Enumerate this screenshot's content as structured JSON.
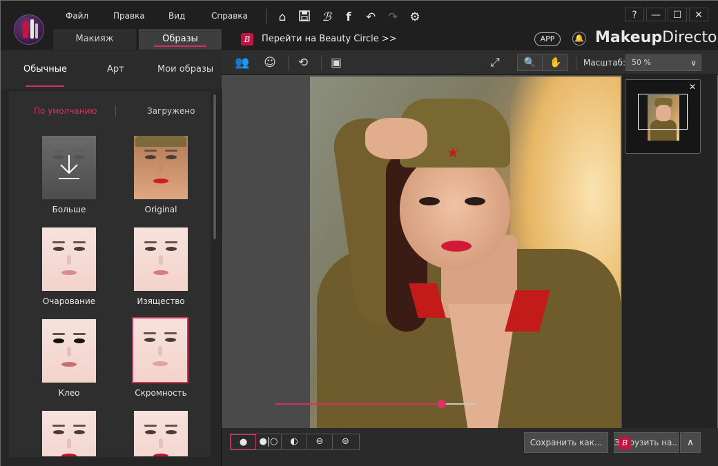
{
  "menu": {
    "file": "Файл",
    "edit": "Правка",
    "view": "Вид",
    "help": "Справка"
  },
  "main_tabs": [
    {
      "label": "Макияж"
    },
    {
      "label": "Образы"
    }
  ],
  "beauty_circle": {
    "badge": "B",
    "label": "Перейти на Beauty Circle >>"
  },
  "header_right": {
    "app_pill": "APP",
    "brand_prefix": "Makeup",
    "brand_suffix": "Director"
  },
  "window_buttons": {
    "help": "?",
    "minimize": "—",
    "maximize": "☐",
    "close": "✕"
  },
  "sub_tabs": [
    {
      "label": "Обычные"
    },
    {
      "label": "Арт"
    },
    {
      "label": "Мои образы"
    }
  ],
  "filters": {
    "default": "По умолчанию",
    "downloaded": "Загружено"
  },
  "looks": [
    {
      "label": "Больше"
    },
    {
      "label": "Original"
    },
    {
      "label": "Очарование"
    },
    {
      "label": "Изящество"
    },
    {
      "label": "Клео"
    },
    {
      "label": "Скромность"
    },
    {
      "label": ""
    },
    {
      "label": ""
    }
  ],
  "toolbar": {
    "scale_label": "Масштаб:",
    "scale_value": "50 %"
  },
  "slider": {
    "value": 0.83
  },
  "bottom": {
    "save_as": "Сохранить как...",
    "upload": "Загрузить на...",
    "upload_badge": "B"
  },
  "icons": {
    "home": "home-icon",
    "save": "save-icon",
    "beauty": "beauty-circle-icon",
    "facebook": "facebook-icon",
    "undo": "undo-icon",
    "redo": "redo-icon",
    "settings": "gear-icon"
  },
  "colors": {
    "accent": "#d6325f",
    "panel": "#262626",
    "canvas": "#4a4a4a"
  }
}
